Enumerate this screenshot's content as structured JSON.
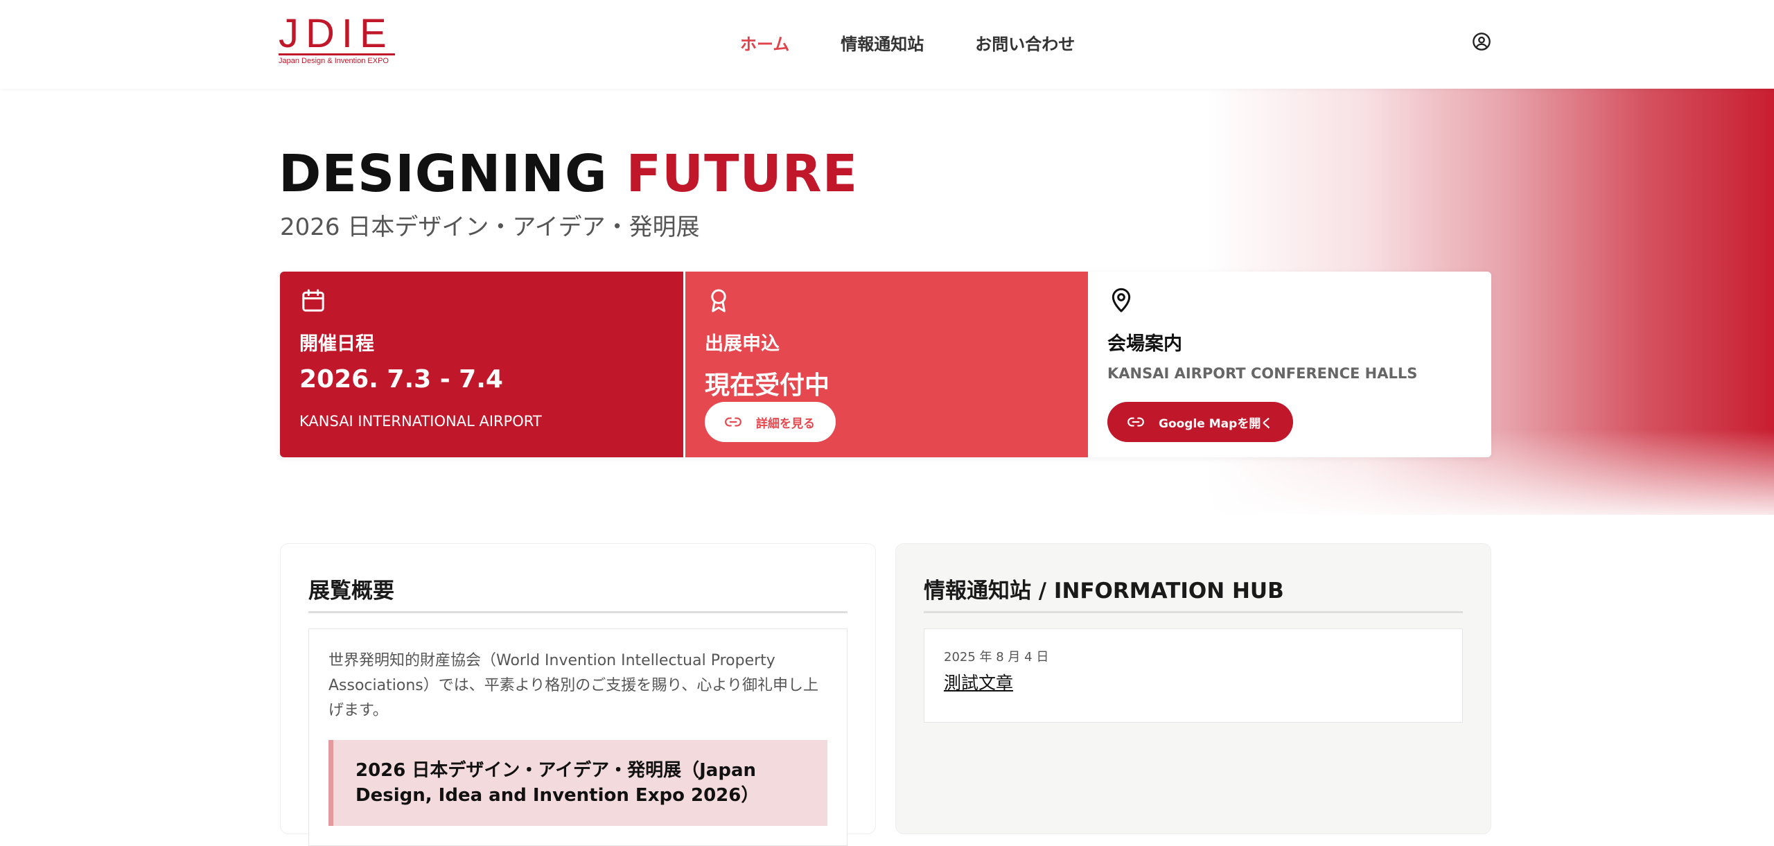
{
  "header": {
    "logo_text": "JDIE",
    "logo_sub": "Japan Design & Invention EXPO",
    "nav": [
      {
        "label": "ホーム",
        "active": true
      },
      {
        "label": "情報通知站",
        "active": false
      },
      {
        "label": "お問い合わせ",
        "active": false
      }
    ],
    "user_icon": "user-circle-icon"
  },
  "hero": {
    "title_part1": "DESIGNING ",
    "title_part2": "FUTURE",
    "subtitle": "2026 日本デザイン・アイデア・発明展"
  },
  "cards": {
    "schedule": {
      "icon": "calendar-icon",
      "label": "開催日程",
      "value": "2026. 7.3 - 7.4",
      "note": "KANSAI INTERNATIONAL AIRPORT"
    },
    "application": {
      "icon": "award-icon",
      "label": "出展申込",
      "value": "現在受付中",
      "button_label": "詳細を見る"
    },
    "venue": {
      "icon": "map-pin-icon",
      "label": "会場案内",
      "note": "KANSAI AIRPORT CONFERENCE HALLS",
      "button_label": "Google Mapを開く"
    }
  },
  "overview": {
    "title": "展覧概要",
    "intro": "世界発明知的財産協会（World Invention Intellectual Property Associations）では、平素より格別のご支援を賜り、心より御礼申し上げます。",
    "highlight": "2026 日本デザイン・アイデア・発明展（Japan Design, Idea and Invention Expo 2026）"
  },
  "info_hub": {
    "title": "情報通知站 / INFORMATION HUB",
    "items": [
      {
        "date": "2025 年 8 月 4 日",
        "title": "測試文章"
      }
    ]
  },
  "colors": {
    "brand_red": "#c0182a",
    "accent_red": "#e5484f",
    "nav_active": "#e0424a"
  }
}
